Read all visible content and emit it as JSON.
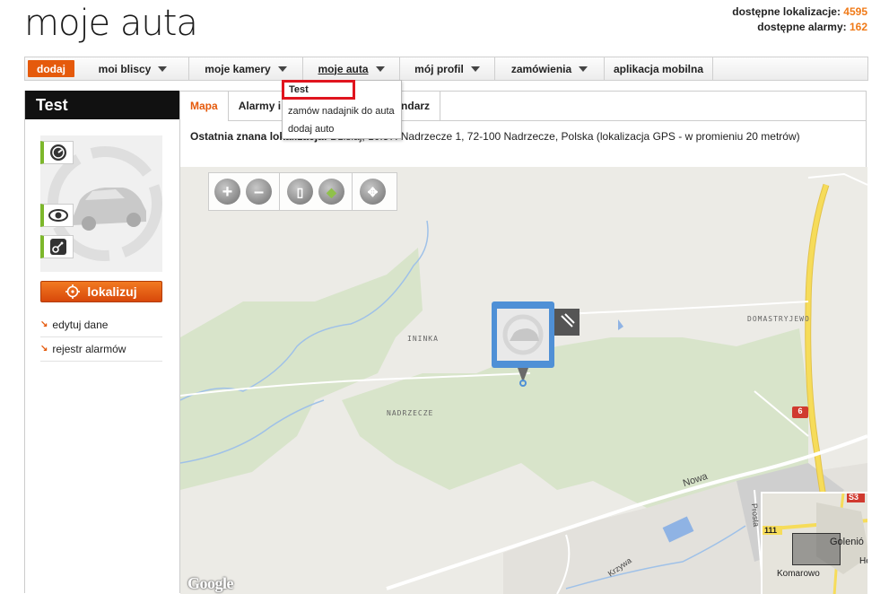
{
  "header": {
    "logo": "moje auta",
    "stat_locations_label": "dostępne lokalizacje:",
    "stat_locations_value": "4595",
    "stat_alarms_label": "dostępne alarmy:",
    "stat_alarms_value": "162"
  },
  "nav": {
    "add": "dodaj",
    "items": [
      {
        "label": "moi bliscy"
      },
      {
        "label": "moje kamery"
      },
      {
        "label": "moje auta"
      },
      {
        "label": "mój profil"
      },
      {
        "label": "zamówienia"
      },
      {
        "label": "aplikacja mobilna"
      }
    ]
  },
  "dropdown": {
    "items": [
      "Test",
      "zamów nadajnik do auta",
      "dodaj auto"
    ]
  },
  "left_panel": {
    "title": "Test",
    "locate_button": "lokalizuj",
    "links": [
      "edytuj dane",
      "rejestr alarmów"
    ]
  },
  "tabs": [
    "Mapa",
    "Alarmy i",
    "ne",
    "Kalendarz"
  ],
  "location": {
    "label": "Ostatnia znana lokalizacja:",
    "text": "Dzisiaj, 10:57: Nadrzecze 1, 72-100 Nadrzecze, Polska (lokalizacja GPS - w promieniu 20 metrów)"
  },
  "map": {
    "places": [
      "ININKA",
      "NADRZECZE",
      "DOMASTRYJEWO"
    ],
    "road_labels": [
      "Nowa",
      "Krzywa",
      "Prosta"
    ],
    "road_number": "6",
    "minimap_labels": [
      "Golenió",
      "Komarowo",
      "He"
    ],
    "minimap_road_numbers": [
      "111",
      "S3"
    ],
    "attribution": "Google",
    "colors": {
      "accent": "#e55a0c",
      "highway": "#f5d43c",
      "forest": "#d6e3c8"
    }
  }
}
